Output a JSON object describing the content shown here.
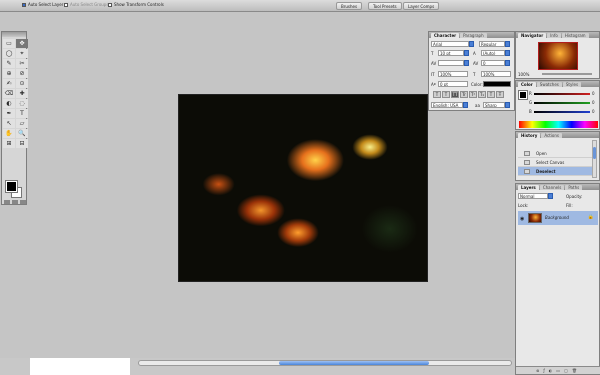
{
  "options_bar": {
    "auto_select_layer": "Auto Select Layer",
    "auto_select_groups": "Auto Select Groups",
    "show_transform_controls": "Show Transform Controls",
    "palette_tabs": [
      "Brushes",
      "Tool Presets",
      "Layer Comps"
    ]
  },
  "toolbox": {
    "tools": [
      "▭",
      "✥",
      "◯",
      "⌖",
      "✎",
      "✂",
      "⊕",
      "⊘",
      "✍",
      "⊙",
      "⌫",
      "✚",
      "◐",
      "◌",
      "✒",
      "T",
      "↖",
      "▱",
      "✋",
      "🔍",
      "⊞",
      "⊟"
    ],
    "active_index": 1
  },
  "character_panel": {
    "tabs": [
      "Character",
      "Paragraph"
    ],
    "font_family": "Arial",
    "font_style": "Regular",
    "size": "10 pt",
    "leading": "(Auto)",
    "kerning": "",
    "tracking": "0",
    "vertical_scale": "100%",
    "horizontal_scale": "100%",
    "baseline": "0 pt",
    "color_label": "Color:",
    "style_buttons": [
      "T",
      "T",
      "TT",
      "Tr",
      "T¹",
      "T₁",
      "T",
      "Ŧ"
    ],
    "language": "English: USA",
    "anti_alias": "Sharp",
    "aa_label": "aa"
  },
  "navigator_panel": {
    "tabs": [
      "Navigator",
      "Info",
      "Histogram"
    ],
    "zoom": "100%"
  },
  "color_panel": {
    "tabs": [
      "Color",
      "Swatches",
      "Styles"
    ],
    "channels": [
      "R",
      "G",
      "B"
    ],
    "channel_colors": [
      "#d02020",
      "#20a020",
      "#2040d0"
    ],
    "values": [
      "0",
      "0",
      "0"
    ]
  },
  "history_panel": {
    "tabs": [
      "History",
      "Actions"
    ],
    "items": [
      "Open",
      "Select Canvas",
      "Deselect"
    ],
    "selected_index": 2
  },
  "layers_panel": {
    "tabs": [
      "Layers",
      "Channels",
      "Paths"
    ],
    "blend_mode": "Normal",
    "opacity_label": "Opacity:",
    "lock_label": "Lock:",
    "fill_label": "Fill:",
    "layer_name": "Background",
    "footer_icons": [
      "⊗",
      "ƒ",
      "◐",
      "▭",
      "▢",
      "🗑"
    ]
  }
}
